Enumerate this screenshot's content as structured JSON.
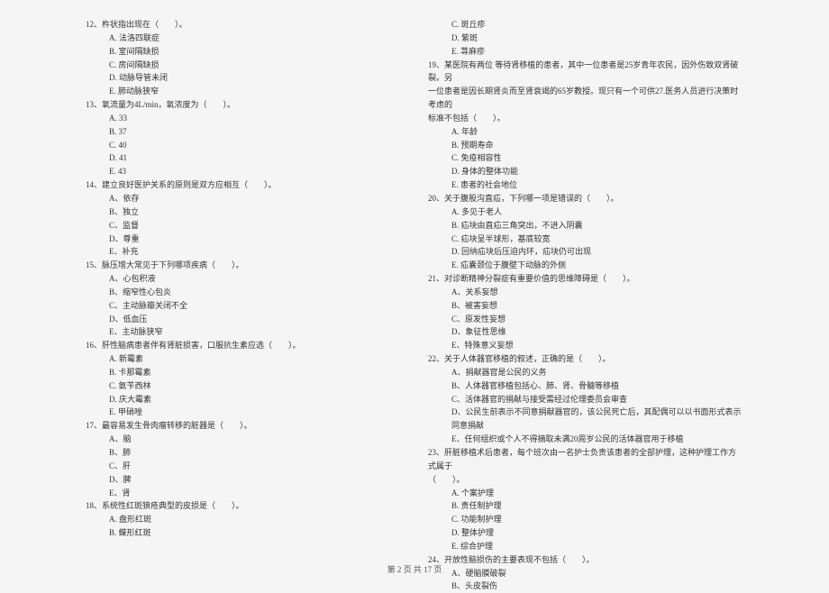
{
  "footer": "第 2 页 共 17 页",
  "left": [
    {
      "type": "q",
      "text": "12、杵状指出现在（　　）。"
    },
    {
      "type": "o",
      "text": "A. 法洛四联症"
    },
    {
      "type": "o",
      "text": "B. 室间隔缺损"
    },
    {
      "type": "o",
      "text": "C. 房间隔缺损"
    },
    {
      "type": "o",
      "text": "D. 动脉导管未闭"
    },
    {
      "type": "o",
      "text": "E. 肺动脉狭窄"
    },
    {
      "type": "q",
      "text": "13、氧流量为4L/min，氧浓度为（　　）。"
    },
    {
      "type": "o",
      "text": "A. 33"
    },
    {
      "type": "o",
      "text": "B. 37"
    },
    {
      "type": "o",
      "text": "C. 40"
    },
    {
      "type": "o",
      "text": "D. 41"
    },
    {
      "type": "o",
      "text": "E. 43"
    },
    {
      "type": "q",
      "text": "14、建立良好医护关系的原则是双方应相互（　　）。"
    },
    {
      "type": "o",
      "text": "A、依存"
    },
    {
      "type": "o",
      "text": "B、独立"
    },
    {
      "type": "o",
      "text": "C、监督"
    },
    {
      "type": "o",
      "text": "D、尊重"
    },
    {
      "type": "o",
      "text": "E、补充"
    },
    {
      "type": "q",
      "text": "15、脉压增大常见于下列哪项疾病（　　）。"
    },
    {
      "type": "o",
      "text": "A、心包积液"
    },
    {
      "type": "o",
      "text": "B、缩窄性心包炎"
    },
    {
      "type": "o",
      "text": "C、主动脉瓣关闭不全"
    },
    {
      "type": "o",
      "text": "D、低血压"
    },
    {
      "type": "o",
      "text": "E、主动脉狭窄"
    },
    {
      "type": "q",
      "text": "16、肝性脑病患者伴有肾脏损害，口服抗生素应选（　　）。"
    },
    {
      "type": "o",
      "text": "A. 新霉素"
    },
    {
      "type": "o",
      "text": "B. 卡那霉素"
    },
    {
      "type": "o",
      "text": "C. 氨苄西林"
    },
    {
      "type": "o",
      "text": "D. 庆大霉素"
    },
    {
      "type": "o",
      "text": "E. 甲硝唑"
    },
    {
      "type": "q",
      "text": "17、最容易发生骨肉瘤转移的脏器是（　　）。"
    },
    {
      "type": "o",
      "text": "A、脑"
    },
    {
      "type": "o",
      "text": "B、肺"
    },
    {
      "type": "o",
      "text": "C、肝"
    },
    {
      "type": "o",
      "text": "D、脾"
    },
    {
      "type": "o",
      "text": "E、肾"
    },
    {
      "type": "q",
      "text": "18、系统性红斑狼疮典型的皮损是（　　）。"
    },
    {
      "type": "o",
      "text": "A. 盘形红斑"
    },
    {
      "type": "o",
      "text": "B. 蝶形红斑"
    }
  ],
  "right": [
    {
      "type": "o",
      "text": "C. 斑丘疹"
    },
    {
      "type": "o",
      "text": "D. 紫斑"
    },
    {
      "type": "o",
      "text": "E. 荨麻疹"
    },
    {
      "type": "q",
      "text": "19、某医院有两位 等待肾移植的患者，其中一位患者是25岁青年农民，因外伤致双肾破裂。另"
    },
    {
      "type": "c",
      "text": "一位患者是因长期肾炎而至肾衰竭的65岁教授。现只有一个可供27.医务人员进行决策时考虑的"
    },
    {
      "type": "c",
      "text": "标准不包括（　　）。"
    },
    {
      "type": "o",
      "text": "A. 年龄"
    },
    {
      "type": "o",
      "text": "B. 预期寿命"
    },
    {
      "type": "o",
      "text": "C. 免疫相容性"
    },
    {
      "type": "o",
      "text": "D. 身体的整体功能"
    },
    {
      "type": "o",
      "text": "E. 患者的社会地位"
    },
    {
      "type": "q",
      "text": "20、关于腹股沟直疝，下列哪一项是错误的（　　）。"
    },
    {
      "type": "o",
      "text": "A. 多见于老人"
    },
    {
      "type": "o",
      "text": "B. 疝块由直疝三角突出，不进入阴囊"
    },
    {
      "type": "o",
      "text": "C. 疝块呈半球形，基底较宽"
    },
    {
      "type": "o",
      "text": "D. 回纳疝块后压迫内环，疝块仍可出现"
    },
    {
      "type": "o",
      "text": "E. 疝囊颈位于腹壁下动脉的外侧"
    },
    {
      "type": "q",
      "text": "21、对诊断精神分裂症有重要价值的思维障碍是（　　）。"
    },
    {
      "type": "o",
      "text": "A、关系妄想"
    },
    {
      "type": "o",
      "text": "B、被害妄想"
    },
    {
      "type": "o",
      "text": "C、原发性妄想"
    },
    {
      "type": "o",
      "text": "D、象征性思维"
    },
    {
      "type": "o",
      "text": "E、特殊意义妄想"
    },
    {
      "type": "q",
      "text": "22、关于人体器官移植的叙述，正确的是（　　）。"
    },
    {
      "type": "o",
      "text": "A、捐献器官是公民的义务"
    },
    {
      "type": "o",
      "text": "B、人体器官移植包括心、肺、肾、骨髓等移植"
    },
    {
      "type": "o",
      "text": "C、活体器官的捐献与接受需经过伦理委员会审查"
    },
    {
      "type": "o",
      "text": "D、公民生前表示不同意捐献器官的，该公民死亡后，其配偶可以以书面形式表示同意捐献"
    },
    {
      "type": "o",
      "text": "E、任何组织或个人不得摘取未满20周岁公民的活体器官用于移植"
    },
    {
      "type": "q",
      "text": "23、肝脏移植术后患者，每个班次由一名护士负责该患者的全部护理，这种护理工作方式属于"
    },
    {
      "type": "c",
      "text": "（　　）。"
    },
    {
      "type": "o",
      "text": "A. 个案护理"
    },
    {
      "type": "o",
      "text": "B. 责任制护理"
    },
    {
      "type": "o",
      "text": "C. 功能制护理"
    },
    {
      "type": "o",
      "text": "D. 整体护理"
    },
    {
      "type": "o",
      "text": "E. 综合护理"
    },
    {
      "type": "q",
      "text": "24、开放性脑损伤的主要表现不包括（　　）。"
    },
    {
      "type": "o",
      "text": "A、硬脑膜破裂"
    },
    {
      "type": "o",
      "text": "B、头皮裂伤"
    }
  ]
}
